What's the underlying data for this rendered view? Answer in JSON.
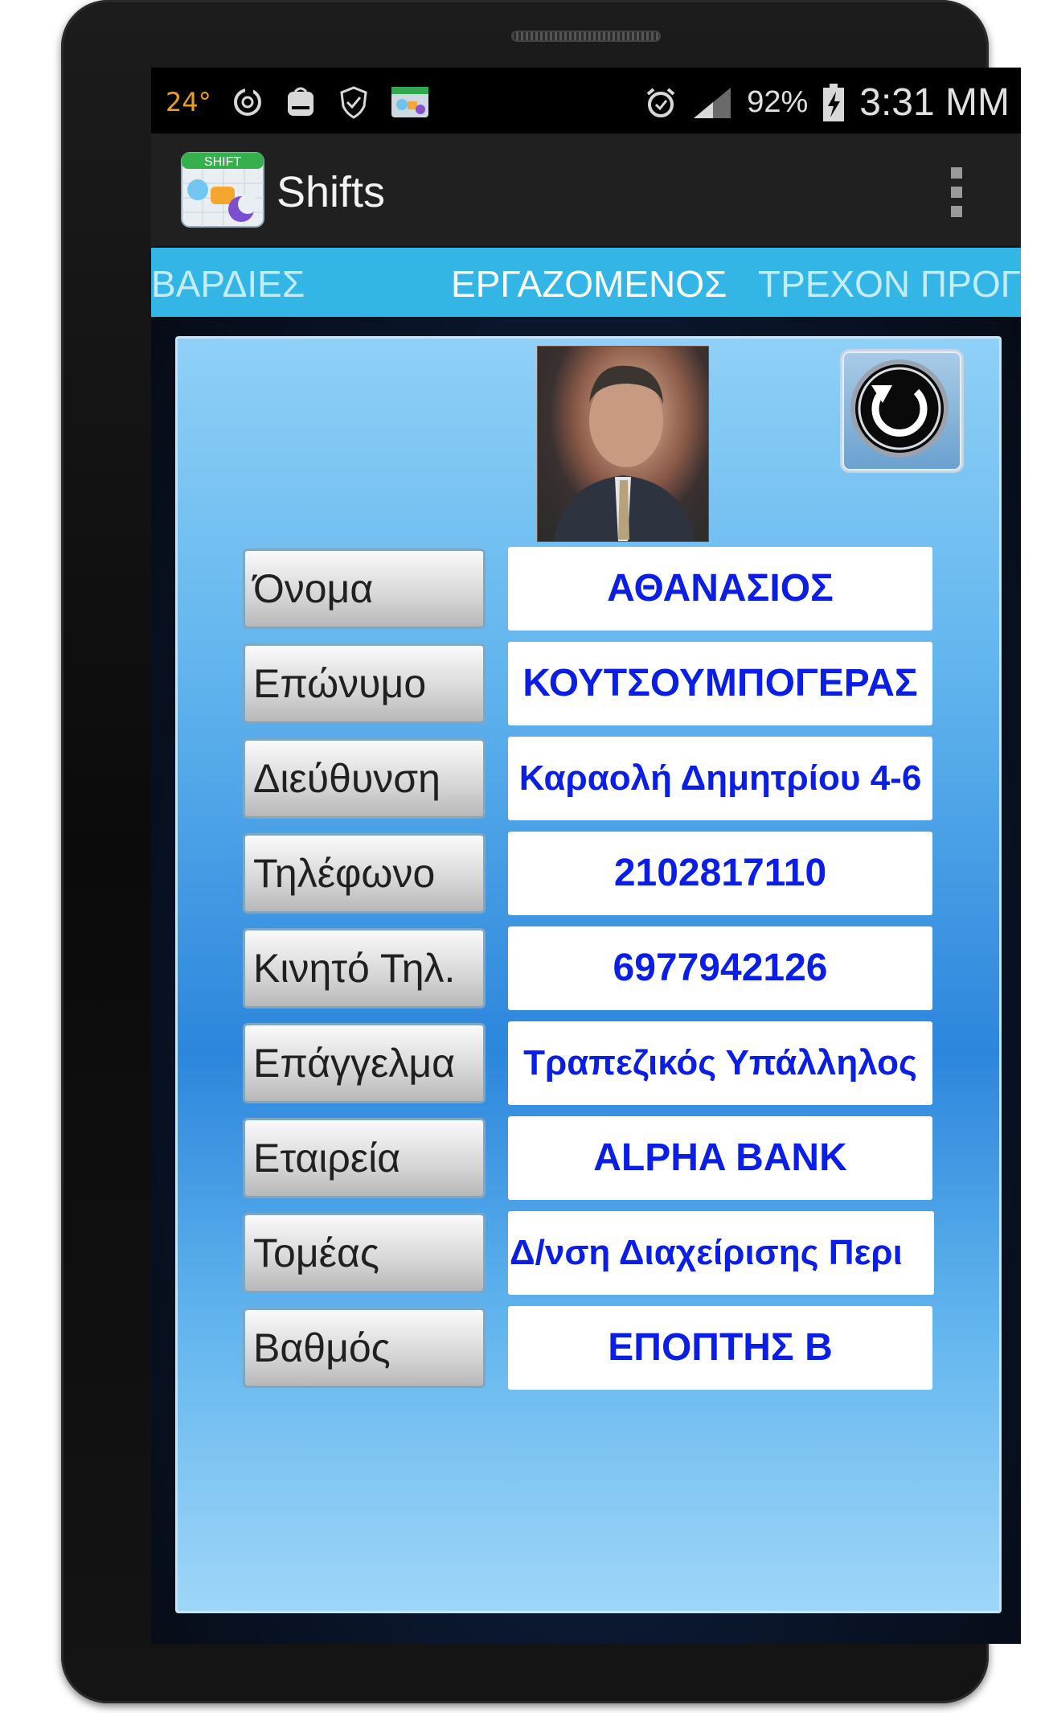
{
  "status_bar": {
    "temperature": "24°",
    "battery_percent": "92%",
    "time": "3:31 MM",
    "left_icons": [
      "sync-icon",
      "galaxy-store-icon",
      "shield-check-icon",
      "shifts-notification-icon"
    ],
    "right_icons": [
      "alarm-icon",
      "signal-icon",
      "battery-charging-icon"
    ]
  },
  "action_bar": {
    "title": "Shifts",
    "logo_label": "SHIFT"
  },
  "tabs": [
    {
      "label": "ΒΑΡΔΙΕΣ",
      "selected": false
    },
    {
      "label": "ΕΡΓΑΖΟΜΕΝΟΣ",
      "selected": true
    },
    {
      "label": "ΤΡΕΧΟΝ ΠΡΟΓΙ",
      "selected": false
    }
  ],
  "employee": {
    "fields": [
      {
        "label": "Όνομα",
        "value": "ΑΘΑΝΑΣΙΟΣ"
      },
      {
        "label": "Επώνυμο",
        "value": "ΚΟΥΤΣΟΥΜΠΟΓΕΡΑΣ"
      },
      {
        "label": "Διεύθυνση",
        "value": "Καραολή Δημητρίου 4-6"
      },
      {
        "label": "Τηλέφωνο",
        "value": "2102817110"
      },
      {
        "label": "Κινητό Τηλ.",
        "value": "6977942126"
      },
      {
        "label": "Επάγγελμα",
        "value": "Τραπεζικός Υπάλληλος"
      },
      {
        "label": "Εταιρεία",
        "value": "ALPHA BANK"
      },
      {
        "label": "Τομέας",
        "value": "Δ/νση Διαχείρισης Περι"
      },
      {
        "label": "Βαθμός",
        "value": "ΕΠΟΠΤΗΣ Β"
      }
    ]
  },
  "colors": {
    "tab_bar": "#33b5e5",
    "value_text": "#0b1ee6",
    "action_bar": "#202020"
  }
}
